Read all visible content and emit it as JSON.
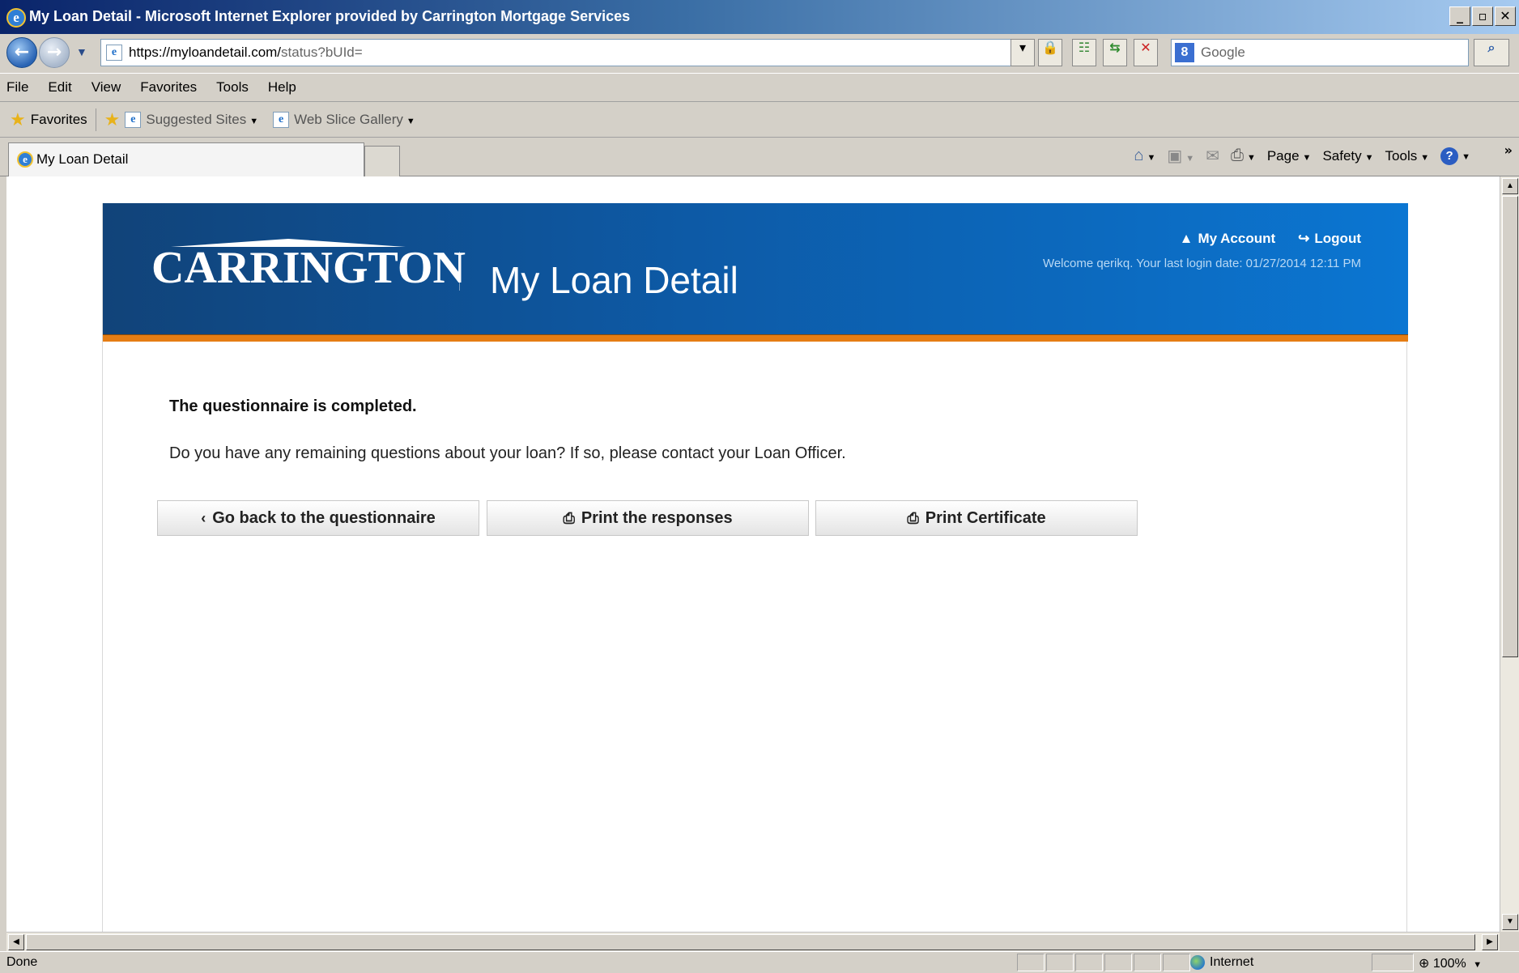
{
  "window": {
    "title": "My Loan Detail - Microsoft Internet Explorer provided by Carrington Mortgage Services",
    "controls": [
      "_",
      "▫",
      "✕"
    ]
  },
  "address": {
    "url_host": "https://myloandetail.com/",
    "url_path": "status?bUId=",
    "search_placeholder": "Google"
  },
  "menu": [
    "File",
    "Edit",
    "View",
    "Favorites",
    "Tools",
    "Help"
  ],
  "favorites": {
    "label": "Favorites",
    "links": [
      "Suggested Sites",
      "Web Slice Gallery"
    ]
  },
  "tab": {
    "label": "My Loan Detail"
  },
  "commandbar": {
    "page": "Page",
    "safety": "Safety",
    "tools": "Tools"
  },
  "site": {
    "logo": "CARRINGTON",
    "title": "My Loan Detail",
    "my_account": "My Account",
    "logout": "Logout",
    "welcome": "Welcome qerikq. Your last login date: 01/27/2014 12:11 PM"
  },
  "content": {
    "heading": "The questionnaire is completed.",
    "message": "Do you have any remaining questions about your loan? If so, please contact your Loan Officer.",
    "buttons": {
      "back": "Go back to the questionnaire",
      "print_responses": "Print the responses",
      "print_certificate": "Print Certificate"
    }
  },
  "status": {
    "text": "Done",
    "zone": "Internet",
    "zoom": "100%"
  },
  "colors": {
    "header_dark": "#114379",
    "header_light": "#0b76d2",
    "accent_orange": "#e57d14"
  }
}
